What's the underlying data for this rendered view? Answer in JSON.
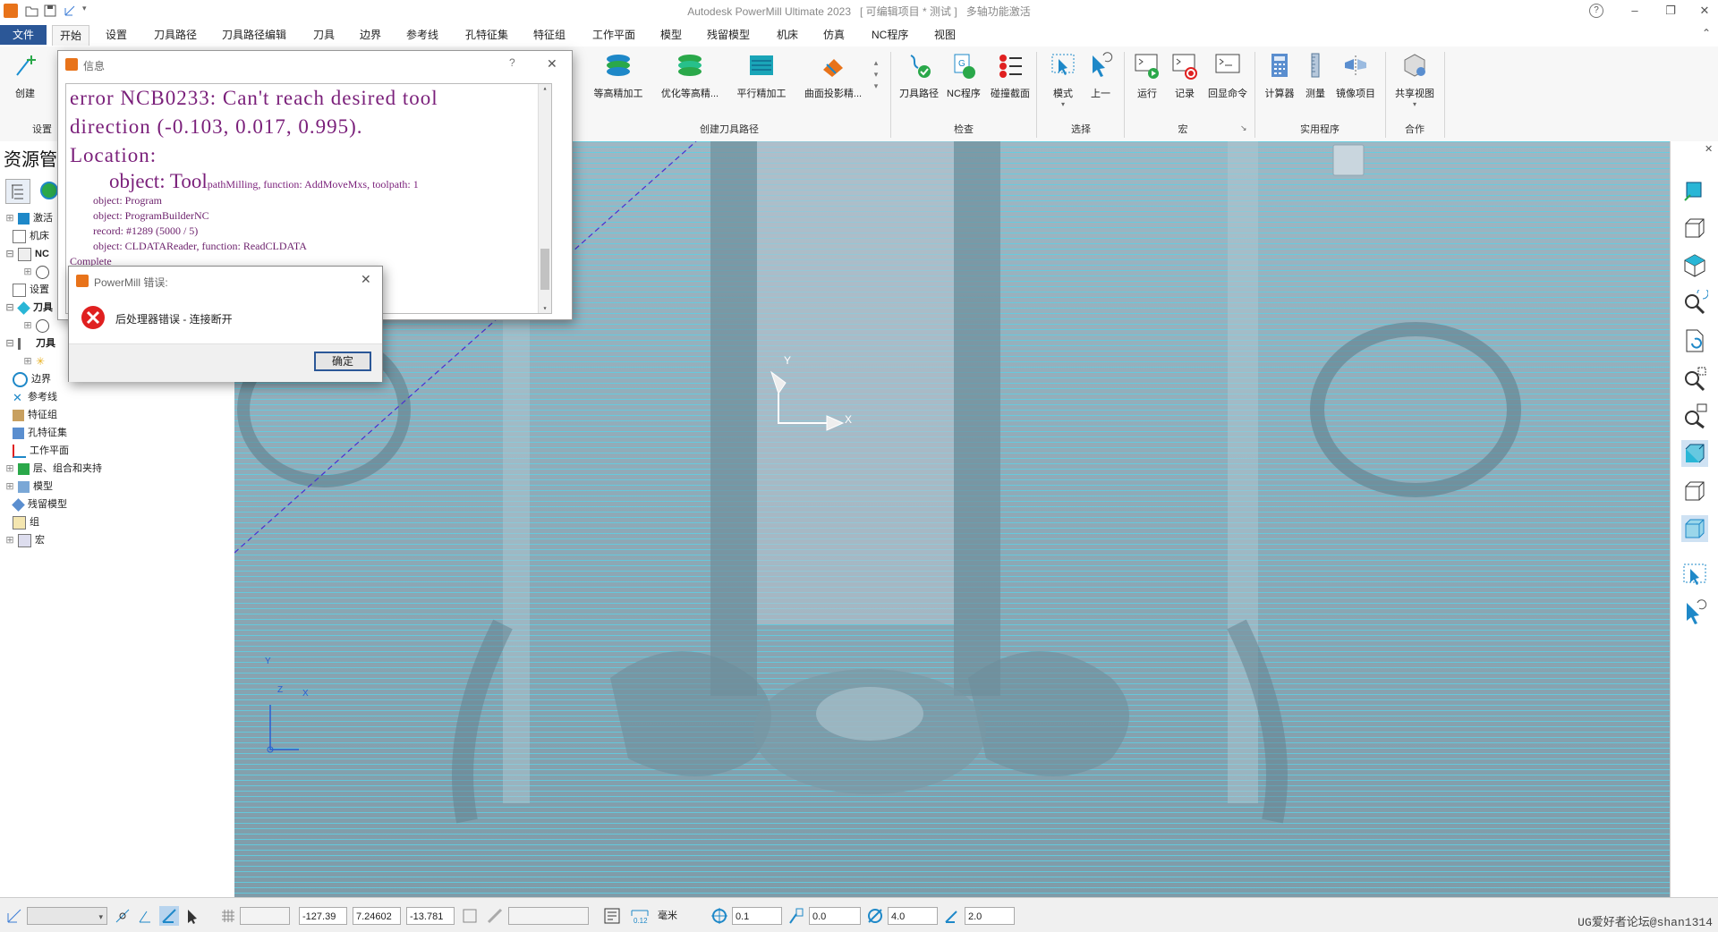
{
  "window": {
    "title": "Autodesk PowerMill Ultimate 2023",
    "project_status": "[ 可编辑项目 * 测试 ]",
    "feature_note": "多轴功能激活",
    "help": "?",
    "minimize": "–",
    "restore": "❐",
    "close": "✕"
  },
  "menu": [
    "文件",
    "开始",
    "设置",
    "刀具路径",
    "刀具路径编辑",
    "刀具",
    "边界",
    "参考线",
    "孔特征集",
    "特征组",
    "工作平面",
    "模型",
    "残留模型",
    "机床",
    "仿真",
    "NC程序",
    "视图"
  ],
  "ribbon": {
    "create_label": "创建",
    "settings_label": "设置",
    "toolpath_buttons": [
      "等高精加工",
      "优化等高精...",
      "平行精加工",
      "曲面投影精..."
    ],
    "group_create_toolpath": "创建刀具路径",
    "check_buttons": [
      "刀具路径",
      "NC程序",
      "碰撞截面"
    ],
    "group_check": "检查",
    "select_buttons": [
      "模式",
      "上一"
    ],
    "group_select": "选择",
    "macro_buttons": [
      "运行",
      "记录",
      "回显命令"
    ],
    "group_macro": "宏",
    "utility_buttons": [
      "计算器",
      "测量",
      "镜像项目"
    ],
    "group_utility": "实用程序",
    "collab_buttons": [
      "共享视图"
    ],
    "group_collab": "合作"
  },
  "explorer": {
    "title": "资源管",
    "items": [
      {
        "label": "激活",
        "depth": 1
      },
      {
        "label": "机床",
        "depth": 1
      },
      {
        "label": "NC",
        "depth": 1
      },
      {
        "label": "",
        "depth": 2
      },
      {
        "label": "设置",
        "depth": 1
      },
      {
        "label": "刀具",
        "depth": 1
      },
      {
        "label": "",
        "depth": 2
      },
      {
        "label": "刀具",
        "depth": 1
      },
      {
        "label": "",
        "depth": 2
      },
      {
        "label": "边界",
        "depth": 1
      },
      {
        "label": "参考线",
        "depth": 1
      },
      {
        "label": "特征组",
        "depth": 1
      },
      {
        "label": "孔特征集",
        "depth": 1
      },
      {
        "label": "工作平面",
        "depth": 1
      },
      {
        "label": "层、组合和夹持",
        "depth": 1
      },
      {
        "label": "模型",
        "depth": 1
      },
      {
        "label": "残留模型",
        "depth": 1
      },
      {
        "label": "组",
        "depth": 1
      },
      {
        "label": "宏",
        "depth": 1
      }
    ]
  },
  "info_dialog": {
    "title": "信息",
    "help": "?",
    "close": "✕",
    "line1": "error NCB0233: Can't reach desired tool",
    "line2": "direction (-0.103, 0.017, 0.995).",
    "line3": "Location:",
    "line4_big": "object: Tool",
    "line4_small": "pathMilling, function: AddMoveMxs, toolpath: 1",
    "line5": "object: Program",
    "line6": "object: ProgramBuilderNC",
    "line7": "record: #1289 (5000 / 5)",
    "line8": "object: CLDATAReader, function: ReadCLDATA",
    "line9": "Complete"
  },
  "error_dialog": {
    "title": "PowerMill 错误:",
    "message": "后处理器错误 - 连接断开",
    "ok": "确定",
    "close": "✕"
  },
  "viewport": {
    "axis_y": "Y",
    "axis_x": "X",
    "mini_y": "Y",
    "mini_z": "Z",
    "mini_x": "X"
  },
  "status": {
    "x": "-127.39",
    "y": "7.24602",
    "z": "-13.781",
    "unit": "毫米",
    "tolerance": "0.1",
    "stock": "0.0",
    "diameter": "4.0",
    "stepover": "2.0",
    "watermark": "UG爱好者论坛@shan1314"
  },
  "colors": {
    "file_menu": "#2b5797",
    "error_red": "#e02020",
    "info_text": "#7a1f7a",
    "toolpath_cyan": "#5ecfe4"
  }
}
